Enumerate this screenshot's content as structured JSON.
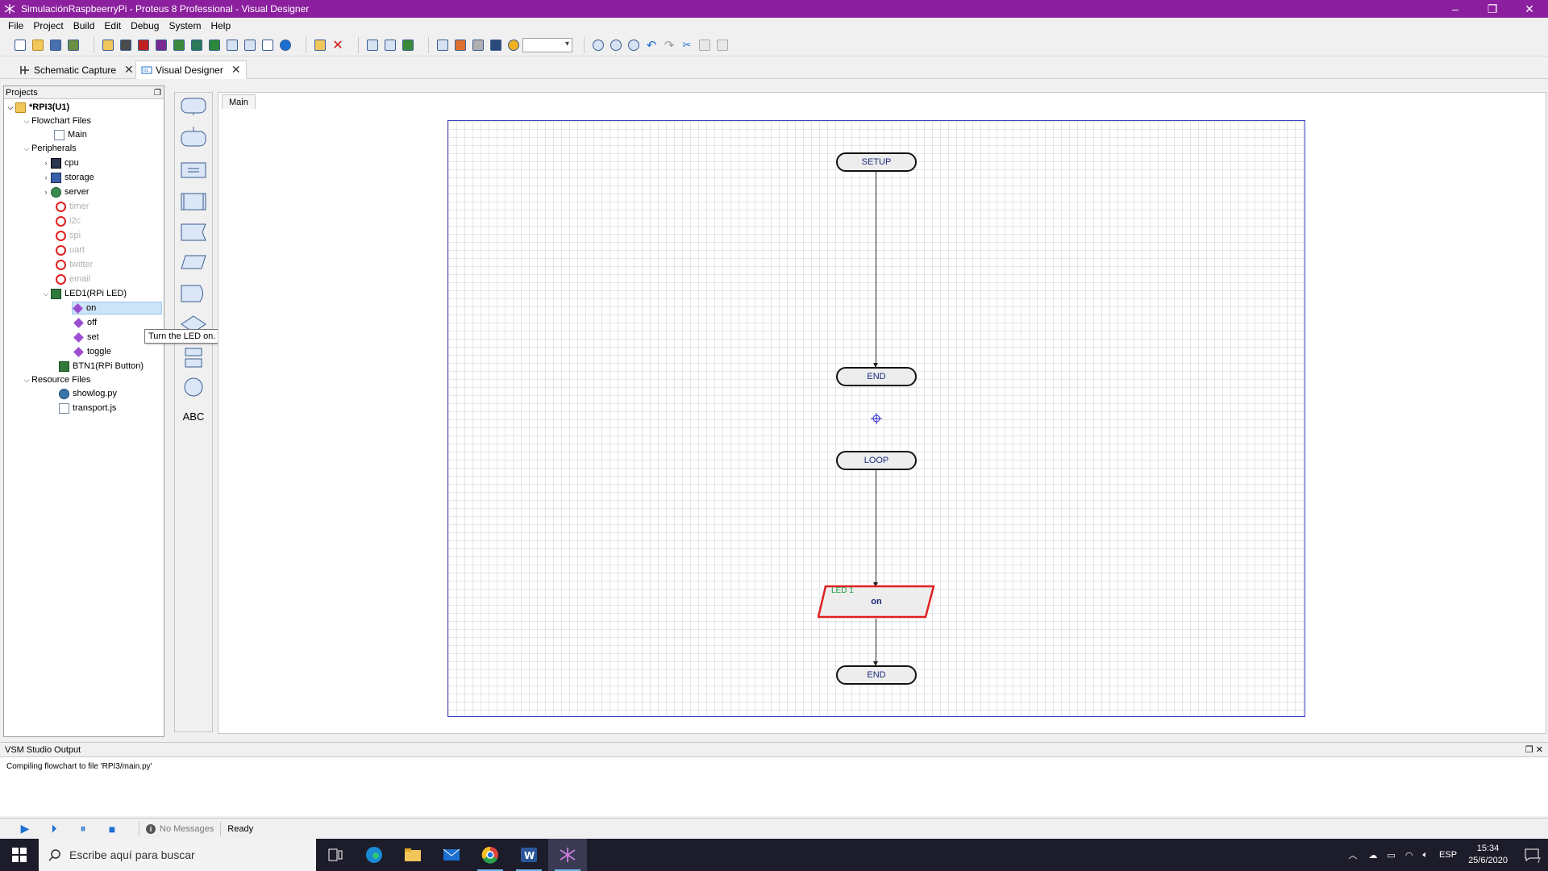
{
  "window": {
    "title": "SimulaciónRaspbeerryPi - Proteus 8 Professional - Visual Designer",
    "controls": [
      "–",
      "❐",
      "✕"
    ]
  },
  "menu": [
    "File",
    "Project",
    "Build",
    "Edit",
    "Debug",
    "System",
    "Help"
  ],
  "tabs": [
    {
      "label": "Schematic Capture",
      "active": false
    },
    {
      "label": "Visual Designer",
      "active": true
    }
  ],
  "projects": {
    "header": "Projects",
    "tree": [
      {
        "label": "*RPI3(U1)",
        "icon": "folder-icon"
      },
      {
        "label": "Flowchart Files",
        "icon": "none"
      },
      {
        "label": "Main",
        "icon": "file-icon"
      },
      {
        "label": "Peripherals",
        "icon": "none"
      },
      {
        "label": "cpu",
        "icon": "chip-icon"
      },
      {
        "label": "storage",
        "icon": "storage-icon"
      },
      {
        "label": "server",
        "icon": "server-icon"
      },
      {
        "label": "timer",
        "icon": "disabled-icon"
      },
      {
        "label": "i2c",
        "icon": "disabled-icon"
      },
      {
        "label": "spi",
        "icon": "disabled-icon"
      },
      {
        "label": "uart",
        "icon": "disabled-icon"
      },
      {
        "label": "twitter",
        "icon": "disabled-icon"
      },
      {
        "label": "email",
        "icon": "disabled-icon"
      },
      {
        "label": "LED1(RPi LED)",
        "icon": "board-icon"
      },
      {
        "label": "on",
        "icon": "method-icon"
      },
      {
        "label": "off",
        "icon": "method-icon"
      },
      {
        "label": "set",
        "icon": "method-icon"
      },
      {
        "label": "toggle",
        "icon": "method-icon"
      },
      {
        "label": "BTN1(RPi Button)",
        "icon": "board-icon"
      },
      {
        "label": "Resource Files",
        "icon": "none"
      },
      {
        "label": "showlog.py",
        "icon": "python-icon"
      },
      {
        "label": "transport.js",
        "icon": "file-icon"
      }
    ]
  },
  "tooltip": "Turn the LED on.",
  "palette": {
    "text_tool": "ABC"
  },
  "editor": {
    "subtab": "Main",
    "flowchart": {
      "setup": "SETUP",
      "end1": "END",
      "loop": "LOOP",
      "led_block_label": "LED 1",
      "led_block_method": "on",
      "end2": "END"
    }
  },
  "output": {
    "title": "VSM Studio Output",
    "message": "Compiling flowchart to file 'RPI3/main.py'"
  },
  "status": {
    "messages": "No Messages",
    "state": "Ready"
  },
  "taskbar": {
    "search_placeholder": "Escribe aquí para buscar",
    "language": "ESP",
    "time": "15:34",
    "date": "25/6/2020",
    "notifications": "7"
  },
  "colors": {
    "titlebar": "#8b1f9e",
    "canvas_border": "#3f3fbf",
    "selected_block": "#e02020"
  }
}
